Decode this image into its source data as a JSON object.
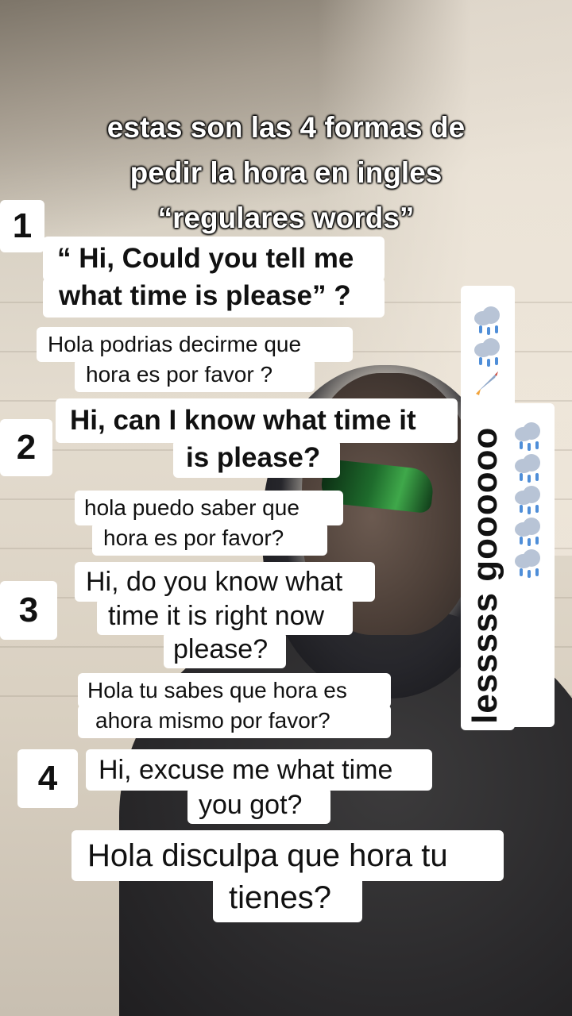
{
  "title": "estas son las 4 formas de\npedir la hora en ingles\n“regulares words”",
  "items": [
    {
      "number": "1",
      "english_lines": [
        "“ Hi, Could you tell me",
        "what time is please” ?"
      ],
      "spanish_lines": [
        "Hola podrias decirme que",
        "hora es por favor ?"
      ]
    },
    {
      "number": "2",
      "english_lines": [
        "Hi, can I know what time it",
        "is please?"
      ],
      "spanish_lines": [
        "hola puedo saber que",
        "hora es por favor?"
      ]
    },
    {
      "number": "3",
      "english_lines": [
        "Hi, do you know what",
        "time it is right now",
        "please?"
      ],
      "spanish_lines": [
        "Hola tu sabes que hora es",
        "ahora mismo por favor?"
      ]
    },
    {
      "number": "4",
      "english_lines": [
        "Hi, excuse me what time",
        "you got?"
      ],
      "spanish_lines": [
        "Hola disculpa que hora tu",
        "tienes?"
      ]
    }
  ],
  "side_sticker": {
    "text": "lesssss goooooo",
    "icons": [
      "cloud-with-rain-icon",
      "cloud-with-rain-icon",
      "rocket-icon",
      "cloud-with-rain-icon",
      "cloud-with-rain-icon",
      "cloud-with-rain-icon",
      "cloud-with-rain-icon",
      "cloud-with-rain-icon"
    ]
  }
}
